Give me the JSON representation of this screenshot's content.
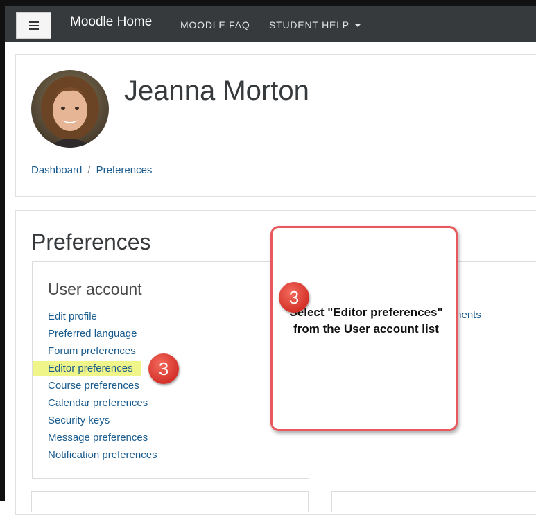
{
  "navbar": {
    "brand": "Moodle Home",
    "links": [
      {
        "label": "MOODLE FAQ"
      },
      {
        "label": "STUDENT HELP"
      }
    ]
  },
  "header": {
    "user_name": "Jeanna Morton",
    "breadcrumb": [
      {
        "label": "Dashboard"
      },
      {
        "label": "Preferences"
      }
    ]
  },
  "main": {
    "page_title": "Preferences",
    "user_account": {
      "title": "User account",
      "items": [
        {
          "label": "Edit profile"
        },
        {
          "label": "Preferred language"
        },
        {
          "label": "Forum preferences"
        },
        {
          "label": "Editor preferences"
        },
        {
          "label": "Course preferences"
        },
        {
          "label": "Calendar preferences"
        },
        {
          "label": "Security keys"
        },
        {
          "label": "Message preferences"
        },
        {
          "label": "Notification preferences"
        }
      ]
    },
    "partial_link": "ments"
  },
  "callout": {
    "step": "3",
    "text": "Select \"Editor preferences\" from the User account list",
    "border_color": "#e8585c"
  },
  "step_badge": "3"
}
